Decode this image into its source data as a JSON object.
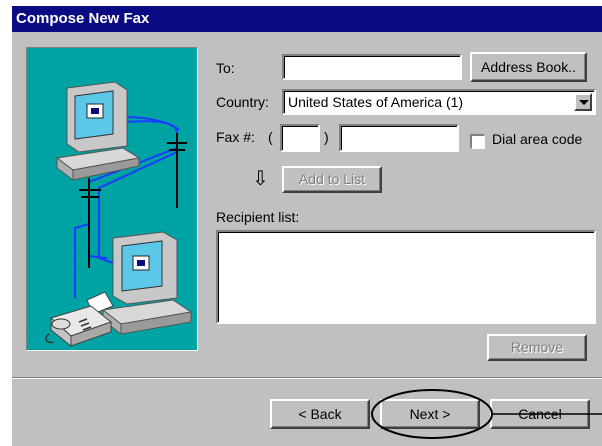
{
  "window": {
    "title": "Compose New Fax"
  },
  "form": {
    "to_label": "To:",
    "to_value": "",
    "address_book_label": "Address Book..",
    "country_label": "Country:",
    "country_value": "United States of America (1)",
    "fax_label": "Fax #:",
    "paren_open": "(",
    "paren_close": ")",
    "area_code_value": "",
    "fax_number_value": "",
    "dial_area_code_label": "Dial area code",
    "dial_area_code_checked": false,
    "down_arrow_glyph": "⇩",
    "add_to_list_label": "Add to List",
    "recipient_list_label": "Recipient list:",
    "recipients": [],
    "remove_label": "Remove"
  },
  "footer": {
    "back_label": "< Back",
    "next_label": "Next >",
    "cancel_label": "Cancel"
  },
  "annotation": {
    "highlight": "next-button",
    "color": "#000000"
  },
  "colors": {
    "titlebar": "#0a0a82",
    "dialog_bg": "#c0c0c0",
    "illustration_bg": "#00a3a3",
    "wire": "#1a3cff"
  },
  "icons": {
    "illustration": "fax-computers-illustration",
    "combo": "chevron-down-icon",
    "add_arrow": "down-arrow-icon"
  }
}
